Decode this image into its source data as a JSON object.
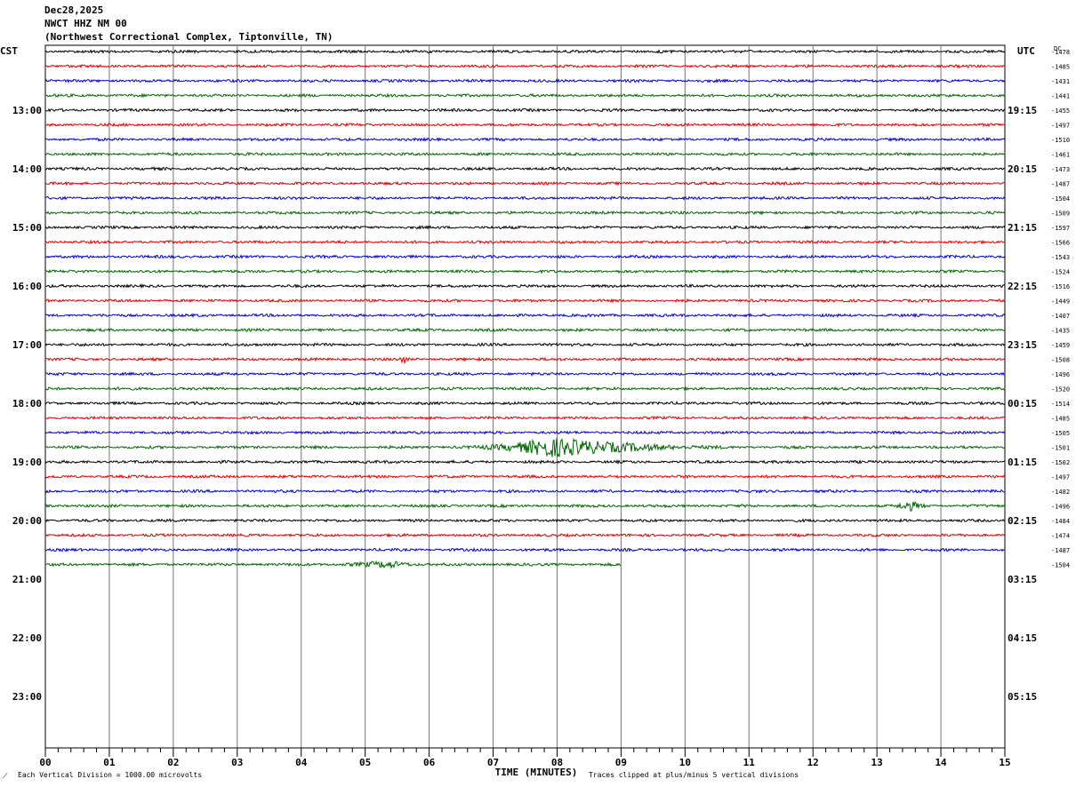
{
  "header": {
    "date": "Dec28,2025",
    "station": "NWCT HHZ NM 00",
    "location": "(Northwest Correctional Complex, Tiptonville, TN)"
  },
  "chart_data": {
    "type": "line",
    "title": "NWCT HHZ NM 00",
    "xlabel": "TIME (MINUTES)",
    "xlim": [
      0,
      15
    ],
    "x_ticks": [
      "00",
      "01",
      "02",
      "03",
      "04",
      "05",
      "06",
      "07",
      "08",
      "09",
      "10",
      "11",
      "12",
      "13",
      "14",
      "15"
    ],
    "left_axis_label": "CST",
    "right_axis_label": "UTC",
    "dc_label": "DC",
    "rows_per_hour": 4,
    "total_rows": 48,
    "start_hour_cst": 12,
    "left_hour_labels": [
      "13:00",
      "14:00",
      "15:00",
      "16:00",
      "17:00",
      "18:00",
      "19:00",
      "20:00",
      "21:00",
      "22:00",
      "23:00"
    ],
    "right_hour_labels": [
      "19:15",
      "20:15",
      "21:15",
      "22:15",
      "23:15",
      "00:15",
      "01:15",
      "02:15",
      "03:15",
      "04:15",
      "05:15"
    ],
    "trace_colors": [
      "#000000",
      "#dd0000",
      "#0000cc",
      "#006600"
    ],
    "grid": true,
    "traces_filled": 36,
    "last_trace_end_minute": 9.0,
    "dc_offsets": [
      "-1478",
      "-1485",
      "-1431",
      "-1441",
      "-1455",
      "-1497",
      "-1510",
      "-1461",
      "-1473",
      "-1487",
      "-1504",
      "-1509",
      "-1597",
      "-1566",
      "-1543",
      "-1524",
      "-1516",
      "-1449",
      "-1407",
      "-1435",
      "-1459",
      "-1508",
      "-1496",
      "-1520",
      "-1514",
      "-1485",
      "-1505",
      "-1501",
      "-1502",
      "-1497",
      "-1482",
      "-1496",
      "-1484",
      "-1474",
      "-1487",
      "-1504"
    ],
    "events": [
      {
        "row": 27,
        "start_min": 6.4,
        "peak_min": 7.9,
        "end_min": 11.0,
        "amplitude": 10
      },
      {
        "row": 31,
        "start_min": 13.2,
        "peak_min": 13.5,
        "end_min": 13.9,
        "amplitude": 5
      },
      {
        "row": 21,
        "start_min": 5.5,
        "peak_min": 5.6,
        "end_min": 5.7,
        "amplitude": 4
      },
      {
        "row": 35,
        "start_min": 4.2,
        "peak_min": 5.4,
        "end_min": 6.0,
        "amplitude": 3
      }
    ]
  },
  "footer": {
    "scale_note": "Each Vertical Division = 1000.00 microvolts",
    "clip_note": "Traces clipped at plus/minus 5 vertical divisions"
  }
}
